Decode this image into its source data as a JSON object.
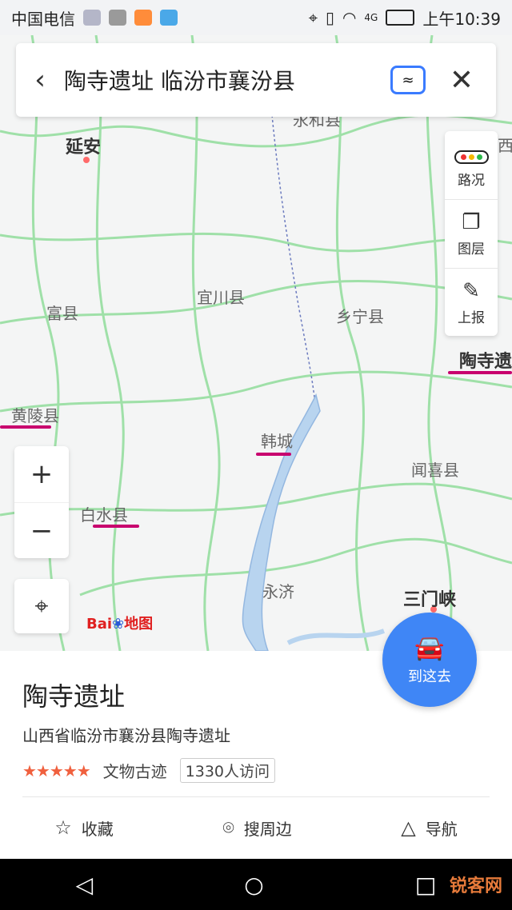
{
  "status_bar": {
    "carrier": "中国电信",
    "time": "上午10:39",
    "network": "4G"
  },
  "search": {
    "query": "陶寺遗址 临汾市襄汾县"
  },
  "tools": [
    {
      "label": "路况",
      "icon": "traffic-icon"
    },
    {
      "label": "图层",
      "icon": "layers-icon"
    },
    {
      "label": "上报",
      "icon": "report-icon"
    }
  ],
  "map": {
    "places": [
      "延安",
      "富县",
      "宜川县",
      "乡宁县",
      "陶寺遗",
      "黄陵县",
      "韩城",
      "闻喜县",
      "白水县",
      "永济",
      "三门峡",
      "永和县",
      "西"
    ],
    "logo_left": "Bai",
    "logo_right": "地图"
  },
  "zoom": {
    "plus": "+",
    "minus": "−"
  },
  "go_button": {
    "label": "到这去"
  },
  "poi": {
    "name": "陶寺遗址",
    "address": "山西省临汾市襄汾县陶寺遗址",
    "rating_stars": "★★★★★",
    "category": "文物古迹",
    "visits": "1330人访问"
  },
  "actions": [
    {
      "label": "收藏",
      "icon": "star-outline-icon"
    },
    {
      "label": "搜周边",
      "icon": "location-pin-icon"
    },
    {
      "label": "导航",
      "icon": "navigation-arrow-icon"
    }
  ],
  "watermark": "锐客网"
}
